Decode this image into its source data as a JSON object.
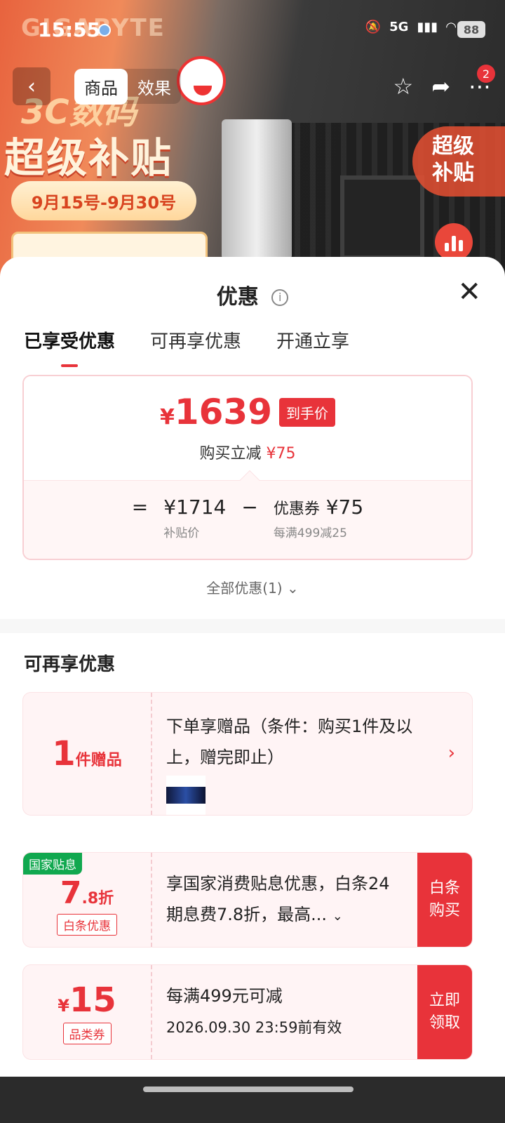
{
  "status_bar": {
    "time": "15:55",
    "network": "5G",
    "battery": "88"
  },
  "banner": {
    "brand": "GIGABYTE",
    "promo_line1": "3C数码",
    "promo_line2": "超级补贴",
    "date_range": "9月15号-9月30号",
    "side_badge_line1": "超级",
    "side_badge_line2": "补贴"
  },
  "nav": {
    "back_icon": "chevron-left-icon",
    "tabs": [
      "商品",
      "效果"
    ],
    "active_tab": "商品",
    "cart_badge": "2"
  },
  "sheet": {
    "title": "优惠",
    "segments": [
      "已享受优惠",
      "可再享优惠",
      "开通立享"
    ],
    "active_segment": "已享受优惠",
    "final_price_currency": "¥",
    "final_price": "1639",
    "final_price_tag": "到手价",
    "reduce_label": "购买立减",
    "reduce_value": "¥75",
    "formula": {
      "equals": "=",
      "base_price": "¥1714",
      "base_label": "补贴价",
      "minus": "−",
      "coupon_name": "优惠券",
      "coupon_value": "¥75",
      "coupon_rule": "每满499减25"
    },
    "all_offers": "全部优惠(1)",
    "section_title": "可再享优惠"
  },
  "offers": [
    {
      "left_number": "1",
      "left_unit": "件赠品",
      "text": "下单享赠品（条件：购买1件及以上，赠完即止）"
    },
    {
      "tag": "国家贴息",
      "left_number": "7",
      "left_decimal": ".8折",
      "left_label": "白条优惠",
      "text": "享国家消费贴息优惠，白条24期息费7.8折，最高...",
      "cta": "白条购买"
    },
    {
      "currency": "¥",
      "left_number": "15",
      "left_label": "品类券",
      "text_line1": "每满499元可减",
      "text_line2": "2026.09.30 23:59前有效",
      "cta": "立即领取"
    }
  ],
  "colors": {
    "accent": "#e8333a",
    "national_tag": "#11a84f"
  }
}
